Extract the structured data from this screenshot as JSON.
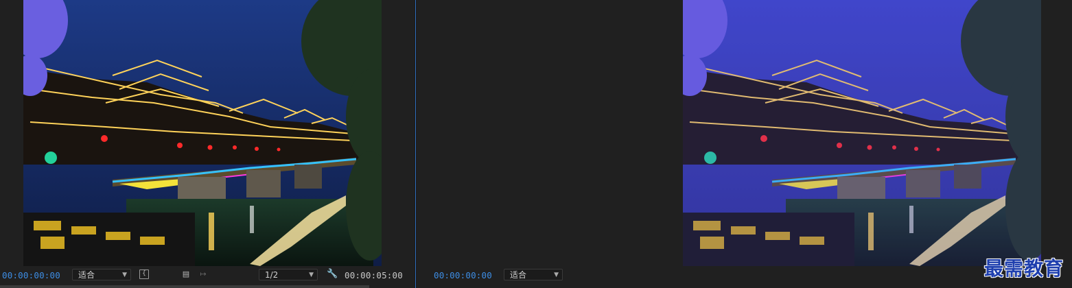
{
  "source_monitor": {
    "timecode_current": "00:00:00:00",
    "fit_label": "适合",
    "resolution_label": "1/2",
    "timecode_duration": "00:00:05:00"
  },
  "program_monitor": {
    "timecode_current": "00:00:00:00",
    "fit_label": "适合"
  },
  "watermark": "最需教育",
  "colors": {
    "timecode_blue": "#3d8de4",
    "panel_bg": "#202020",
    "program_tint": "#4a46c8"
  }
}
